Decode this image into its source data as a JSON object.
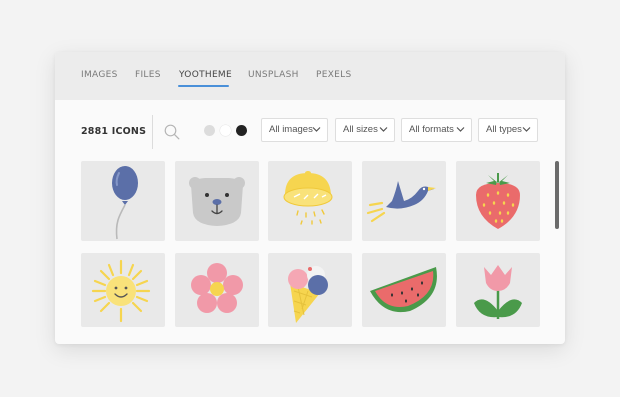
{
  "tabs": [
    {
      "label": "IMAGES"
    },
    {
      "label": "FILES"
    },
    {
      "label": "YOOTHEME"
    },
    {
      "label": "UNSPLASH"
    },
    {
      "label": "PEXELS"
    }
  ],
  "active_tab": "YOOTHEME",
  "toolbar": {
    "count_label": "2881 ICONS",
    "color_swatches": [
      "#dcdcdc",
      "#ffffff",
      "#222222"
    ],
    "filters": [
      {
        "label": "All images"
      },
      {
        "label": "All sizes"
      },
      {
        "label": "All formats"
      },
      {
        "label": "All types"
      }
    ]
  },
  "icons": [
    {
      "name": "balloon-icon"
    },
    {
      "name": "bear-icon"
    },
    {
      "name": "lemon-icon"
    },
    {
      "name": "bird-icon"
    },
    {
      "name": "strawberry-icon"
    },
    {
      "name": "sun-icon"
    },
    {
      "name": "flower-icon"
    },
    {
      "name": "ice-cream-icon"
    },
    {
      "name": "watermelon-icon"
    },
    {
      "name": "tulip-icon"
    }
  ],
  "colors": {
    "accent": "#4a90d9",
    "tile_background": "#e9e9e9",
    "panel_background": "#fafafa",
    "tabbar_background": "#ececec"
  }
}
